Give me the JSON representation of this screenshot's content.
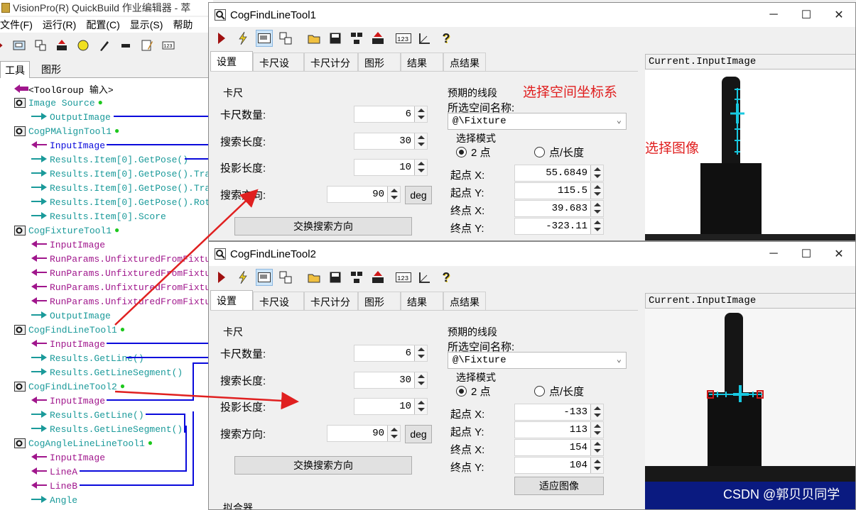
{
  "main": {
    "title": "VisionPro(R) QuickBuild 作业编辑器 - 萃",
    "menu": [
      "文件(F)",
      "运行(R)",
      "配置(C)",
      "显示(S)",
      "帮助"
    ],
    "tabs": [
      "工具",
      "图形"
    ],
    "tree": [
      {
        "text": "<ToolGroup 输入>",
        "color": "blk"
      },
      {
        "text": "Image Source",
        "color": "teal"
      },
      {
        "text": "OutputImage",
        "color": "teal"
      },
      {
        "text": "CogPMAlignTool1",
        "color": "teal"
      },
      {
        "text": "InputImage",
        "color": "blue"
      },
      {
        "text": "Results.Item[0].GetPose()",
        "color": "teal"
      },
      {
        "text": "Results.Item[0].GetPose().Tra",
        "color": "teal"
      },
      {
        "text": "Results.Item[0].GetPose().Tra",
        "color": "teal"
      },
      {
        "text": "Results.Item[0].GetPose().Rot",
        "color": "teal"
      },
      {
        "text": "Results.Item[0].Score",
        "color": "teal"
      },
      {
        "text": "CogFixtureTool1",
        "color": "teal"
      },
      {
        "text": "InputImage",
        "color": "mag"
      },
      {
        "text": "RunParams.UnfixturedFromFixtu",
        "color": "mag"
      },
      {
        "text": "RunParams.UnfixturedFromFixtu",
        "color": "mag"
      },
      {
        "text": "RunParams.UnfixturedFromFixtu",
        "color": "mag"
      },
      {
        "text": "RunParams.UnfixturedFromFixtu",
        "color": "mag"
      },
      {
        "text": "OutputImage",
        "color": "teal"
      },
      {
        "text": "CogFindLineTool1",
        "color": "teal"
      },
      {
        "text": "InputImage",
        "color": "mag"
      },
      {
        "text": "Results.GetLine()",
        "color": "teal"
      },
      {
        "text": "Results.GetLineSegment()",
        "color": "teal"
      },
      {
        "text": "CogFindLineTool2",
        "color": "teal"
      },
      {
        "text": "InputImage",
        "color": "mag"
      },
      {
        "text": "Results.GetLine()",
        "color": "teal"
      },
      {
        "text": "Results.GetLineSegment()",
        "color": "teal"
      },
      {
        "text": "CogAngleLineLineTool1",
        "color": "teal"
      },
      {
        "text": "InputImage",
        "color": "mag"
      },
      {
        "text": "LineA",
        "color": "mag"
      },
      {
        "text": "LineB",
        "color": "mag"
      },
      {
        "text": "Angle",
        "color": "teal"
      }
    ]
  },
  "win1": {
    "title": "CogFindLineTool1",
    "tabs": [
      "设置",
      "卡尺设置",
      "卡尺计分",
      "图形",
      "结果",
      "点结果"
    ],
    "caliper_group": "卡尺",
    "fields": [
      {
        "label": "卡尺数量:",
        "value": "6"
      },
      {
        "label": "搜索长度:",
        "value": "30"
      },
      {
        "label": "投影长度:",
        "value": "10"
      }
    ],
    "direction_label": "搜索方向:",
    "direction_value": "90",
    "deg_button": "deg",
    "swap_button": "交换搜索方向",
    "expected_group": "预期的线段",
    "space_label": "所选空间名称:",
    "space_value": "@\\Fixture",
    "mode_group": "选择模式",
    "mode_options": [
      "2 点",
      "点/长度"
    ],
    "points": [
      {
        "label": "起点 X:",
        "value": "55.6849"
      },
      {
        "label": "起点 Y:",
        "value": "115.5"
      },
      {
        "label": "终点 X:",
        "value": "39.683"
      },
      {
        "label": "终点 Y:",
        "value": "-323.11"
      }
    ],
    "image_header": "Current.InputImage",
    "annotation_space": "选择空间坐标系",
    "annotation_image": "选择图像"
  },
  "win2": {
    "title": "CogFindLineTool2",
    "tabs": [
      "设置",
      "卡尺设置",
      "卡尺计分",
      "图形",
      "结果",
      "点结果"
    ],
    "caliper_group": "卡尺",
    "fields": [
      {
        "label": "卡尺数量:",
        "value": "6"
      },
      {
        "label": "搜索长度:",
        "value": "30"
      },
      {
        "label": "投影长度:",
        "value": "10"
      }
    ],
    "direction_label": "搜索方向:",
    "direction_value": "90",
    "deg_button": "deg",
    "swap_button": "交换搜索方向",
    "expected_group": "预期的线段",
    "space_label": "所选空间名称:",
    "space_value": "@\\Fixture",
    "mode_group": "选择模式",
    "mode_options": [
      "2 点",
      "点/长度"
    ],
    "points": [
      {
        "label": "起点 X:",
        "value": "-133"
      },
      {
        "label": "起点 Y:",
        "value": "113"
      },
      {
        "label": "终点 X:",
        "value": "154"
      },
      {
        "label": "终点 Y:",
        "value": "104"
      }
    ],
    "fit_button": "适应图像",
    "fitter_group": "拟合器",
    "image_header": "Current.InputImage",
    "watermark": "CSDN @郭贝贝同学"
  },
  "colors": {
    "annotation": "#e02020",
    "link_blue": "#0a0adc",
    "link_magenta": "#a0168c",
    "accent_cyan": "#18c8e0"
  }
}
